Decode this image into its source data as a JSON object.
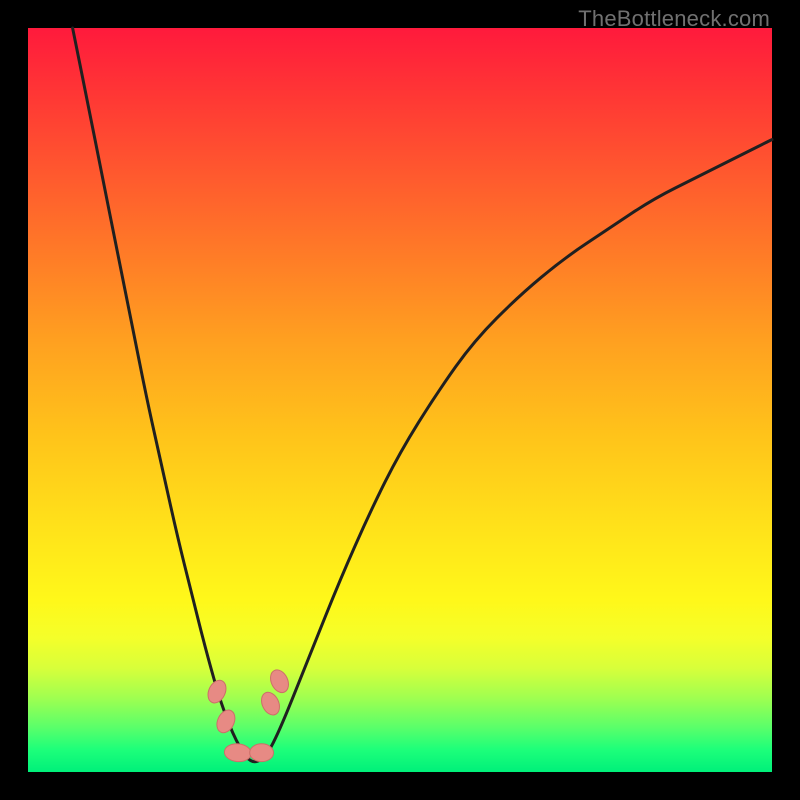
{
  "watermark": "TheBottleneck.com",
  "chart_data": {
    "type": "line",
    "title": "",
    "xlabel": "",
    "ylabel": "",
    "xlim": [
      0,
      100
    ],
    "ylim": [
      0,
      100
    ],
    "grid": false,
    "legend": false,
    "series": [
      {
        "name": "bottleneck-curve",
        "x": [
          6,
          8,
          10,
          12,
          14,
          16,
          18,
          20,
          22,
          24,
          26,
          28,
          30,
          32,
          34,
          38,
          42,
          46,
          50,
          55,
          60,
          66,
          72,
          78,
          84,
          90,
          96,
          100
        ],
        "y": [
          100,
          90,
          80,
          70,
          60,
          50,
          41,
          32,
          24,
          16,
          9,
          4,
          1,
          2,
          6,
          16,
          26,
          35,
          43,
          51,
          58,
          64,
          69,
          73,
          77,
          80,
          83,
          85
        ]
      }
    ],
    "markers": [
      {
        "name": "marker-left-upper",
        "cx": 25.4,
        "cy": 10.8,
        "rx": 1.1,
        "ry": 1.6,
        "angle": 25
      },
      {
        "name": "marker-left-lower",
        "cx": 26.6,
        "cy": 6.8,
        "rx": 1.1,
        "ry": 1.6,
        "angle": 25
      },
      {
        "name": "marker-right-upper",
        "cx": 32.6,
        "cy": 9.2,
        "rx": 1.1,
        "ry": 1.6,
        "angle": -25
      },
      {
        "name": "marker-right-lower",
        "cx": 33.8,
        "cy": 12.2,
        "rx": 1.1,
        "ry": 1.6,
        "angle": -25
      },
      {
        "name": "marker-bottom-left",
        "cx": 28.2,
        "cy": 2.6,
        "rx": 1.8,
        "ry": 1.2,
        "angle": 5
      },
      {
        "name": "marker-bottom-right",
        "cx": 31.4,
        "cy": 2.6,
        "rx": 1.6,
        "ry": 1.2,
        "angle": 0
      }
    ]
  }
}
